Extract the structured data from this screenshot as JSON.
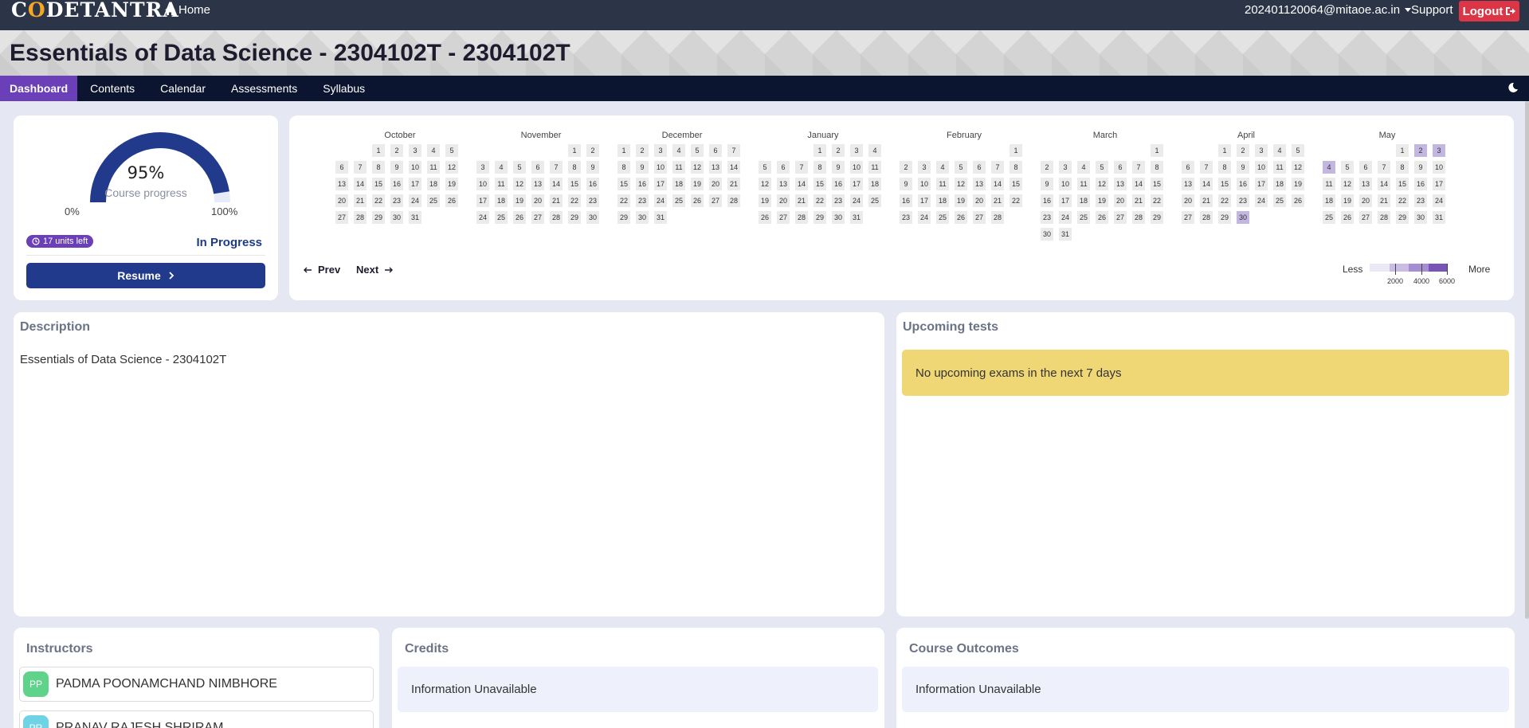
{
  "header": {
    "logo": "CODETANTRA",
    "home": "Home",
    "user": "202401120064@mitaoe.ac.in",
    "support": "Support",
    "logout": "Logout"
  },
  "title": "Essentials of Data Science - 2304102T - 2304102T",
  "nav": {
    "tabs": [
      {
        "label": "Dashboard",
        "active": true
      },
      {
        "label": "Contents",
        "active": false
      },
      {
        "label": "Calendar",
        "active": false
      },
      {
        "label": "Assessments",
        "active": false
      },
      {
        "label": "Syllabus",
        "active": false
      }
    ]
  },
  "progress": {
    "percent_text": "95%",
    "value": 95,
    "label": "Course progress",
    "min": "0%",
    "max": "100%",
    "units_left": "17 units left",
    "status": "In Progress",
    "resume": "Resume"
  },
  "calendar": {
    "months": [
      {
        "name": "October",
        "offset": 2,
        "days": 31,
        "active": {}
      },
      {
        "name": "November",
        "offset": 5,
        "days": 30,
        "active": {}
      },
      {
        "name": "December",
        "offset": 0,
        "days": 31,
        "active": {}
      },
      {
        "name": "January",
        "offset": 3,
        "days": 31,
        "active": {}
      },
      {
        "name": "February",
        "offset": 6,
        "days": 28,
        "active": {}
      },
      {
        "name": "March",
        "offset": 6,
        "days": 31,
        "active": {}
      },
      {
        "name": "April",
        "offset": 2,
        "days": 30,
        "active": {
          "30": 2
        }
      },
      {
        "name": "May",
        "offset": 4,
        "days": 31,
        "active": {
          "2": 2,
          "3": 2,
          "4": 2
        }
      }
    ],
    "prev": "Prev",
    "next": "Next",
    "legend": {
      "less": "Less",
      "more": "More",
      "ticks": [
        "2000",
        "4000",
        "6000"
      ],
      "colors": [
        "#ece8f5",
        "#c9bde3",
        "#a58fd0",
        "#7a55b8"
      ]
    }
  },
  "description": {
    "title": "Description",
    "text": "Essentials of Data Science - 2304102T"
  },
  "upcoming": {
    "title": "Upcoming tests",
    "message": "No upcoming exams in the next 7 days"
  },
  "instructors": {
    "title": "Instructors",
    "items": [
      {
        "initials": "PP",
        "name": "PADMA POONAMCHAND NIMBHORE",
        "color": "#5fd38a"
      },
      {
        "initials": "PR",
        "name": "PRANAV RAJESH SHRIRAM",
        "color": "#6fd3e6"
      }
    ]
  },
  "credits": {
    "title": "Credits",
    "text": "Information Unavailable"
  },
  "outcomes": {
    "title": "Course Outcomes",
    "text": "Information Unavailable"
  },
  "colors": {
    "accent": "#6a3fb8",
    "primary": "#223a8c",
    "logout": "#dc3545",
    "warning": "#f0d776"
  }
}
